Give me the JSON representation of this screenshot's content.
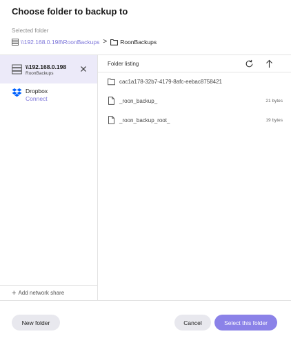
{
  "dialog": {
    "title": "Choose folder to backup to"
  },
  "selected": {
    "label": "Selected folder",
    "path_link": "\\\\192.168.0.198\\RoonBackups",
    "separator": ">",
    "current": "RoonBackups"
  },
  "sidebar": {
    "items": [
      {
        "title": "\\\\192.168.0.198",
        "subtitle": "RoonBackups",
        "icon": "server-icon"
      },
      {
        "title": "Dropbox",
        "subtitle": "Connect",
        "icon": "dropbox-icon"
      }
    ],
    "add_share_label": "Add network share"
  },
  "listing": {
    "title": "Folder listing",
    "entries": [
      {
        "name": "cac1a178-32b7-4179-8afc-eebac8758421",
        "type": "folder",
        "size": ""
      },
      {
        "name": "_roon_backup_",
        "type": "file",
        "size": "21 bytes"
      },
      {
        "name": "_roon_backup_root_",
        "type": "file",
        "size": "19 bytes"
      }
    ]
  },
  "buttons": {
    "new_folder": "New folder",
    "cancel": "Cancel",
    "select": "Select this folder"
  },
  "colors": {
    "accent": "#7b74d9",
    "primary_button": "#8b82e8",
    "active_item_bg": "#eceaf9"
  }
}
